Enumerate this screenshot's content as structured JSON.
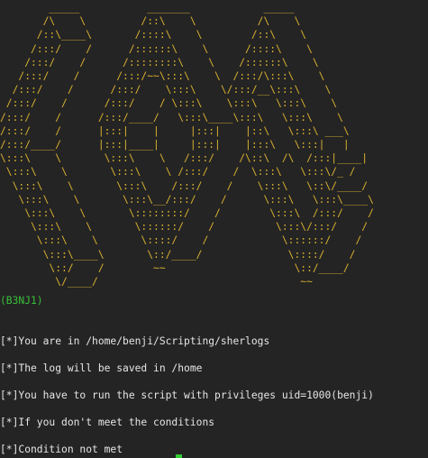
{
  "ascii_art": "        _____           _______            _____\n       /\\    \\         /::\\    \\          /\\    \\\n      /::\\____\\       /::::\\    \\        /::\\    \\\n     /:::/    /      /::::::\\    \\      /::::\\    \\\n    /:::/    /      /::::::::\\    \\    /::::::\\    \\\n   /:::/    /      /:::/~~\\:::\\    \\  /:::/\\:::\\    \\\n  /:::/    /      /:::/    \\:::\\    \\/:::/__\\:::\\    \\\n /:::/    /      /:::/    / \\:::\\    \\:::\\   \\:::\\    \\\n/:::/    /      /:::/____/   \\:::\\____\\:::\\   \\:::\\    \\\n/:::/    /      |:::|    |     |:::|    |::\\   \\:::\\ ___\\\n/:::/____/      |:::|____|     |:::|    |:::\\   \\:::|   |\n\\:::\\    \\       \\:::\\    \\   /:::/    /\\::\\  /\\  /:::|____|\n \\:::\\    \\       \\:::\\    \\ /:::/    /  \\:::\\   \\:::\\/_ /\n  \\:::\\    \\       \\:::\\    /:::/    /    \\:::\\   \\::\\/____/\n   \\:::\\    \\       \\:::\\__/:::/    /      \\:::\\   \\:::\\____\\\n    \\:::\\    \\       \\::::::::/    /        \\:::\\  /:::/    /\n     \\:::\\    \\       \\::::::/    /          \\:::\\/:::/    /\n      \\:::\\    \\       \\::::/    /            \\::::::/    /\n       \\:::\\____\\       \\::/____/              \\::::/    /\n        \\::/    /        ~~                     \\::/____/\n         \\/____/                                 ~~",
  "banner_name": "(B3NJ1)",
  "lines": [
    "[*]You are in /home/benji/Scripting/sherlogs",
    "[*]The log will be saved in /home",
    "[*]You have to run the script with privileges uid=1000(benji)",
    "[*]If you don't meet the conditions",
    "[*]Condition not met"
  ]
}
